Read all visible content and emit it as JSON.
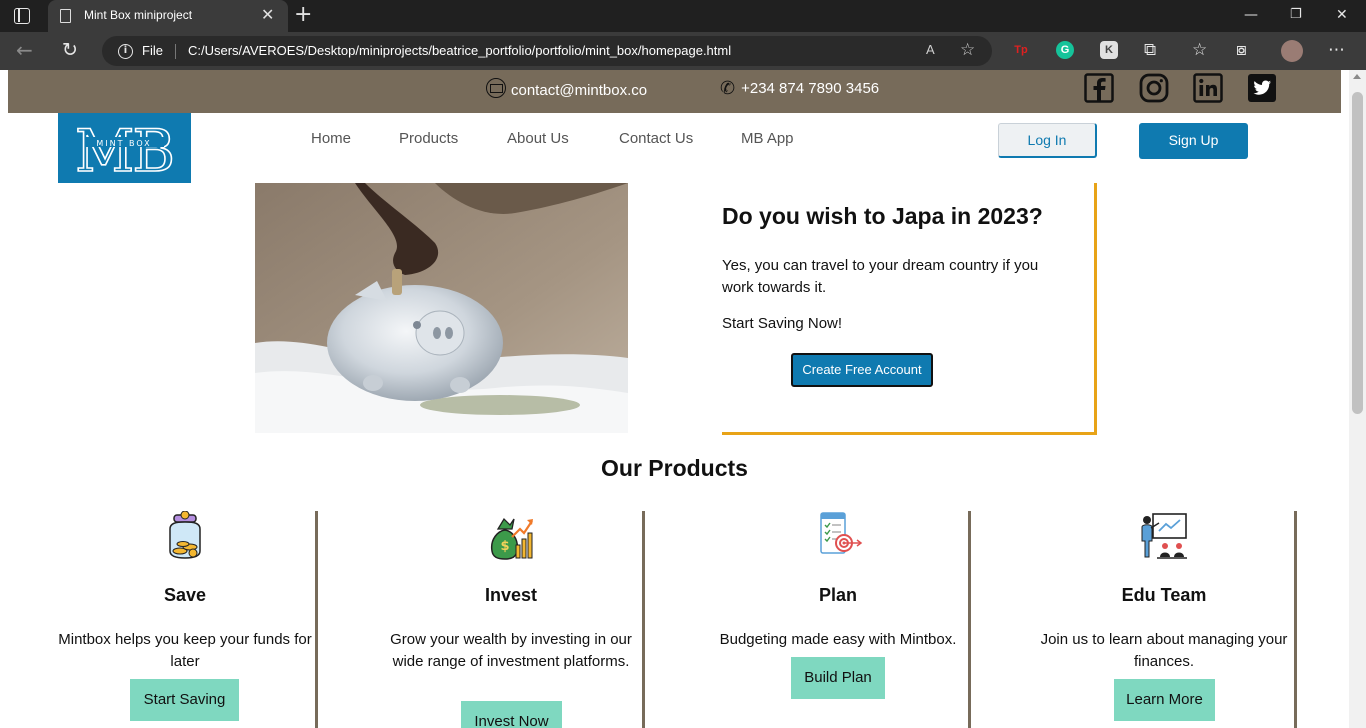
{
  "browser": {
    "tab_title": "Mint Box miniproject",
    "file_label": "File",
    "url": "C:/Users/AVEROES/Desktop/miniprojects/beatrice_portfolio/portfolio/mint_box/homepage.html",
    "read_aloud_label": "A",
    "extensions": [
      "Tp",
      "G",
      "K"
    ]
  },
  "topbar": {
    "email": "contact@mintbox.co",
    "phone": "+234 874 7890 3456",
    "socials": [
      "facebook",
      "instagram",
      "linkedin",
      "twitter"
    ]
  },
  "header": {
    "logo_letters": "MB",
    "logo_subtitle": "MINT BOX",
    "nav": [
      "Home",
      "Products",
      "About Us",
      "Contact Us",
      "MB App"
    ],
    "login_label": "Log In",
    "signup_label": "Sign Up",
    "brand_color": "#0f7ab0"
  },
  "hero": {
    "title": "Do you wish to Japa in 2023?",
    "text": "Yes, you can travel to your dream country if you work towards it.",
    "cta_text": "Start Saving Now!",
    "button_label": "Create Free Account",
    "accent_color": "#e8a317"
  },
  "products": {
    "heading": "Our Products",
    "items": [
      {
        "title": "Save",
        "text": "Mintbox helps you keep your funds for later",
        "button": "Start Saving",
        "icon": "savings-jar-icon"
      },
      {
        "title": "Invest",
        "text": "Grow your wealth by investing in our wide range of investment platforms.",
        "button": "Invest Now",
        "icon": "money-bag-growth-icon"
      },
      {
        "title": "Plan",
        "text": "Budgeting made easy with Mintbox.",
        "button": "Build Plan",
        "icon": "plan-target-icon"
      },
      {
        "title": "Edu Team",
        "text": "Join us to learn about managing your finances.",
        "button": "Learn More",
        "icon": "presentation-board-icon"
      }
    ],
    "button_color": "#7fd8c0"
  }
}
